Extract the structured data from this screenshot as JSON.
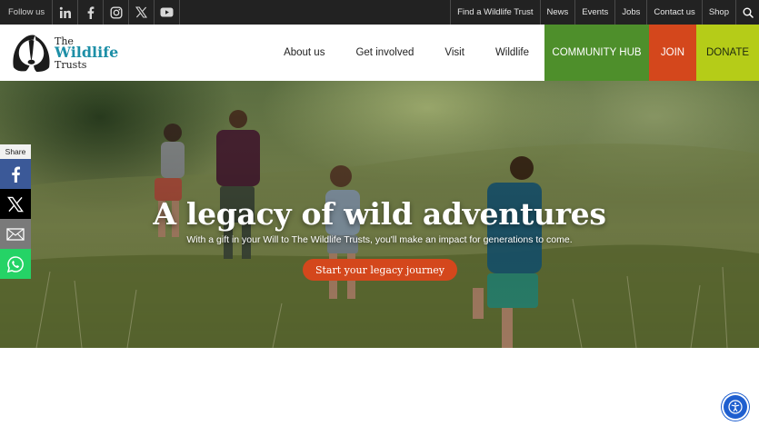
{
  "topbar": {
    "follow_label": "Follow us",
    "social_icons": [
      "linkedin-icon",
      "facebook-icon",
      "instagram-icon",
      "x-icon",
      "youtube-icon"
    ],
    "links": [
      "Find a Wildlife Trust",
      "News",
      "Events",
      "Jobs",
      "Contact us",
      "Shop"
    ],
    "search_icon": "search-icon"
  },
  "logo": {
    "line1": "The",
    "line2": "Wildlife",
    "line3": "Trusts"
  },
  "nav": {
    "items": [
      "About us",
      "Get involved",
      "Visit",
      "Wildlife"
    ],
    "community_hub": "COMMUNITY HUB",
    "join": "JOIN",
    "donate": "DONATE"
  },
  "hero": {
    "title": "A legacy of wild adventures",
    "subtitle": "With a gift in your Will to The Wildlife Trusts, you'll make an impact for generations to come.",
    "cta": "Start your legacy journey"
  },
  "share": {
    "label": "Share",
    "buttons": [
      "facebook-icon",
      "x-icon",
      "email-icon",
      "whatsapp-icon"
    ]
  },
  "colors": {
    "topbar_bg": "#222222",
    "community_hub": "#4e8f2b",
    "join": "#d4471c",
    "donate": "#b5cc18",
    "brand_teal": "#1d8fa7",
    "cta": "#d4471c",
    "accessibility": "#1f5fcf"
  },
  "accessibility_icon": "accessibility-icon"
}
